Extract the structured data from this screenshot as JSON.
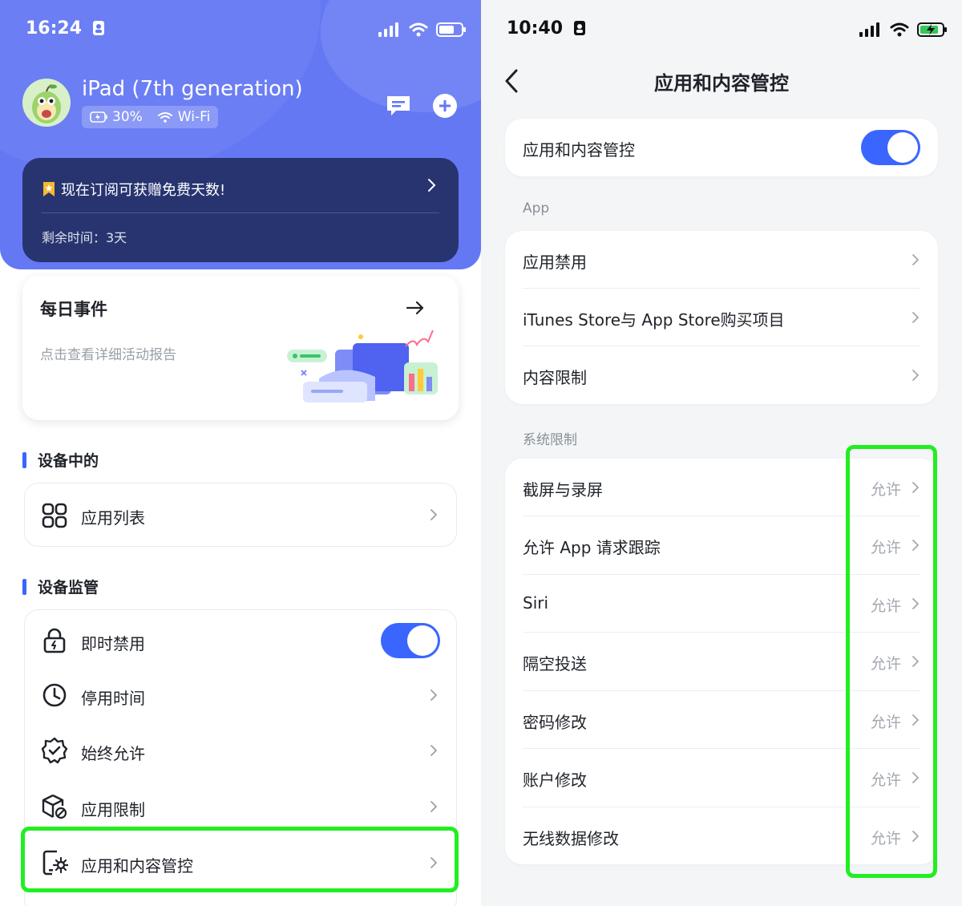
{
  "left": {
    "status_time": "16:24",
    "device": {
      "name": "iPad (7th generation)",
      "battery": "30%",
      "network": "Wi-Fi"
    },
    "promo": {
      "title": "现在订阅可获赠免费天数!",
      "remaining": "剩余时间：3天"
    },
    "daily": {
      "title": "每日事件",
      "subtitle": "点击查看详细活动报告"
    },
    "section_device": {
      "title": "设备中的",
      "items": [
        {
          "label": "应用列表"
        }
      ]
    },
    "section_supervision": {
      "title": "设备监管",
      "items": [
        {
          "label": "即时禁用"
        },
        {
          "label": "停用时间"
        },
        {
          "label": "始终允许"
        },
        {
          "label": "应用限制"
        },
        {
          "label": "应用和内容管控"
        }
      ]
    },
    "colors": {
      "brand": "#6478f4",
      "accent": "#3a66ff",
      "highlight": "#22ee22"
    }
  },
  "right": {
    "status_time": "10:40",
    "title": "应用和内容管控",
    "master_toggle": {
      "label": "应用和内容管控",
      "on": true
    },
    "section_app": {
      "title": "App",
      "items": [
        {
          "label": "应用禁用"
        },
        {
          "label": "iTunes Store与 App Store购买项目"
        },
        {
          "label": "内容限制"
        }
      ]
    },
    "section_system": {
      "title": "系统限制",
      "items": [
        {
          "label": "截屏与录屏",
          "value": "允许"
        },
        {
          "label": "允许 App 请求跟踪",
          "value": "允许"
        },
        {
          "label": "Siri",
          "value": "允许"
        },
        {
          "label": "隔空投送",
          "value": "允许"
        },
        {
          "label": "密码修改",
          "value": "允许"
        },
        {
          "label": "账户修改",
          "value": "允许"
        },
        {
          "label": "无线数据修改",
          "value": "允许"
        }
      ]
    }
  }
}
